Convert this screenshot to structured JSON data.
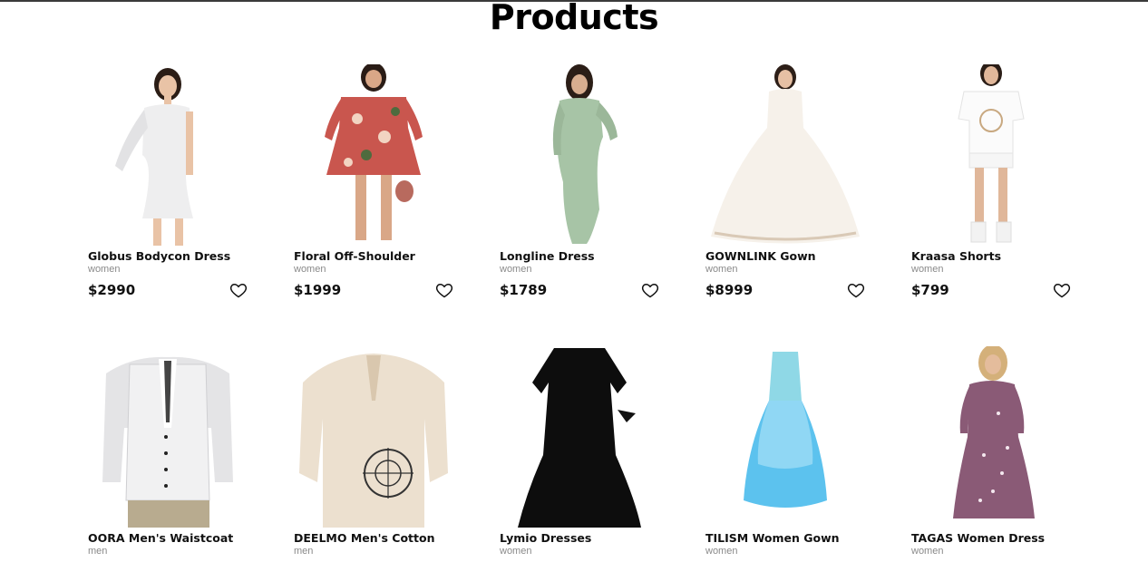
{
  "page": {
    "title": "Products"
  },
  "products": [
    {
      "name": "Globus Bodycon Dress",
      "category": "women",
      "price": "$2990"
    },
    {
      "name": "Floral Off-Shoulder",
      "category": "women",
      "price": "$1999"
    },
    {
      "name": "Longline Dress",
      "category": "women",
      "price": "$1789"
    },
    {
      "name": "GOWNLINK Gown",
      "category": "women",
      "price": "$8999"
    },
    {
      "name": "Kraasa Shorts",
      "category": "women",
      "price": "$799"
    },
    {
      "name": "OORA Men's Waistcoat",
      "category": "men",
      "price": ""
    },
    {
      "name": "DEELMO Men's Cotton",
      "category": "men",
      "price": ""
    },
    {
      "name": "Lymio Dresses",
      "category": "women",
      "price": ""
    },
    {
      "name": "TILISM Women Gown",
      "category": "women",
      "price": ""
    },
    {
      "name": "TAGAS Women Dress",
      "category": "women",
      "price": ""
    }
  ],
  "icons": {
    "wishlist": "heart-outline-icon"
  },
  "colors": {
    "text": "#111111",
    "muted": "#8a8a8a",
    "background": "#ffffff"
  }
}
